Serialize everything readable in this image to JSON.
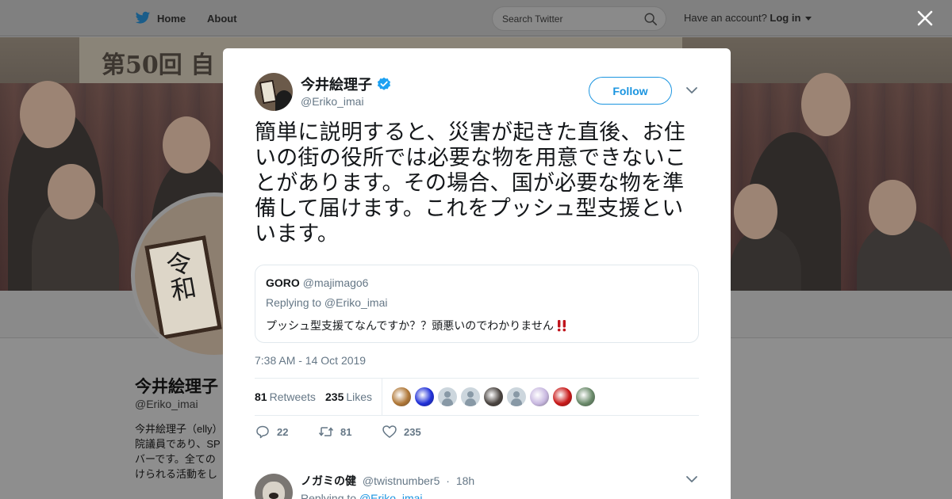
{
  "nav": {
    "home_label": "Home",
    "about_label": "About",
    "search_placeholder": "Search Twitter",
    "account_prompt": "Have an account?",
    "login_label": "Log in"
  },
  "background_profile": {
    "banner_sign_text": "第50回 自",
    "avatar_plaque_text": "令和",
    "name": "今井絵理子",
    "handle": "@Eriko_imai",
    "bio_lines": [
      "今井絵理子（elly）",
      "院議員であり、SP",
      "バーです。全ての",
      "けられる活動をし"
    ]
  },
  "tweet": {
    "author_name": "今井絵理子",
    "author_handle": "@Eriko_imai",
    "follow_label": "Follow",
    "text": "簡単に説明すると、災害が起きた直後、お住いの街の役所では必要な物を用意できないことがあります。その場合、国が必要な物を準備して届けます。これをプッシュ型支援といいます。",
    "quote": {
      "name": "GORO",
      "handle": "@majimago6",
      "replying_to": "Replying to @Eriko_imai",
      "text": "プッシュ型支援てなんですか？？頭悪いのでわかりません"
    },
    "timestamp": "7:38 AM - 14 Oct 2019",
    "stats": {
      "retweets_count": "81",
      "retweets_label": "Retweets",
      "likes_count": "235",
      "likes_label": "Likes"
    },
    "likers": [
      {
        "color": "#b07838",
        "type": "photo"
      },
      {
        "color": "#2030d8",
        "type": "photo"
      },
      {
        "color": "#ccd6dd",
        "type": "default"
      },
      {
        "color": "#ccd6dd",
        "type": "default"
      },
      {
        "color": "#4a4440",
        "type": "photo"
      },
      {
        "color": "#ccd6dd",
        "type": "default"
      },
      {
        "color": "#c8b8e0",
        "type": "photo"
      },
      {
        "color": "#c81818",
        "type": "photo"
      },
      {
        "color": "#6a8a6a",
        "type": "photo"
      }
    ],
    "actions": {
      "replies": "22",
      "retweets": "81",
      "likes": "235"
    }
  },
  "reply": {
    "name": "ノガミの健",
    "handle": "@twistnumber5",
    "separator": "·",
    "time": "18h",
    "replying_prefix": "Replying to",
    "replying_handle": "@Eriko_imai"
  },
  "colors": {
    "accent": "#1b95e0",
    "verified": "#1da1f2",
    "secondary_text": "#657786",
    "overlay": "#8e8e8e"
  }
}
